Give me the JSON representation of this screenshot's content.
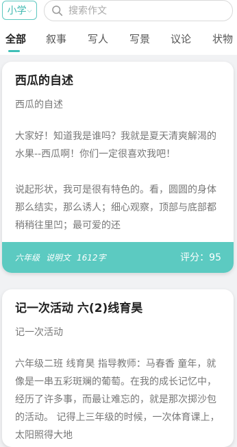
{
  "header": {
    "grade_label": "小学",
    "search_placeholder": "搜索作文"
  },
  "tabs": [
    "全部",
    "叙事",
    "写人",
    "写景",
    "议论",
    "状物"
  ],
  "active_tab": 0,
  "colors": {
    "accent": "#5ccac1",
    "accent_text": "#3fb8b0"
  },
  "articles": [
    {
      "title": "西瓜的自述",
      "subtitle": "西瓜的自述",
      "paragraph1": "大家好！知道我是谁吗？我就是夏天清爽解渴的水果--西瓜啊！你们一定很喜欢我吧！",
      "paragraph2": "说起形状，我可是很有特色的。看，圆圆的身体那么结实，那么诱人；细心观察，顶部与底部都稍稍往里凹；最可爱的还",
      "grade": "六年级",
      "genre": "说明文",
      "words": "1612字",
      "score": "评分：95"
    },
    {
      "title": "记一次活动 六(2)线育昊",
      "subtitle": "记一次活动",
      "paragraph1": "六年级二班 线育昊 指导教师：马春香 童年，就像是一串五彩斑斓的葡萄。在我的成长记忆中，经历了许多事，而最让难忘的，就是那次掷沙包的活动。 记得上三年级的时候，一次体育课上，太阳照得大地"
    }
  ]
}
